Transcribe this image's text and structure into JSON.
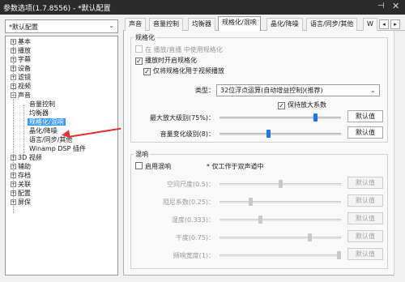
{
  "window": {
    "title": "参数选项(1.7.8556) - *默认配置",
    "pin_glyph": "⊣",
    "close_glyph": "✕"
  },
  "preset": {
    "value": "*默认配置",
    "arrow": "⌄"
  },
  "tree": {
    "items": [
      {
        "label": "基本",
        "expander": "+"
      },
      {
        "label": "播放",
        "expander": "+"
      },
      {
        "label": "字幕",
        "expander": "+"
      },
      {
        "label": "设备",
        "expander": "+"
      },
      {
        "label": "滤镜",
        "expander": "+"
      },
      {
        "label": "视频",
        "expander": "+"
      },
      {
        "label": "声音",
        "expander": "−"
      },
      {
        "label": "音量控制"
      },
      {
        "label": "均衡器"
      },
      {
        "label": "规格化/混响"
      },
      {
        "label": "晶化/降噪"
      },
      {
        "label": "语言/同步/其他"
      },
      {
        "label": "Winamp DSP 插件"
      },
      {
        "label": "3D 视频",
        "expander": "+"
      },
      {
        "label": "辅助",
        "expander": "+"
      },
      {
        "label": "存档",
        "expander": "+"
      },
      {
        "label": "关联",
        "expander": "+"
      },
      {
        "label": "配置",
        "expander": "+"
      },
      {
        "label": "屏保",
        "expander": "+"
      }
    ]
  },
  "tabs": {
    "items": [
      {
        "label": "声音"
      },
      {
        "label": "音量控制"
      },
      {
        "label": "均衡器"
      },
      {
        "label": "规格化/混响"
      },
      {
        "label": "晶化/降噪"
      },
      {
        "label": "语言/同步/其他"
      },
      {
        "label": "W"
      }
    ],
    "scroll_left": "◂",
    "scroll_right": "▸"
  },
  "normalize": {
    "group_title": "规格化",
    "only_passthrough": "在 播放/直播 中使用规格化",
    "enable_on_start": "播放时开启规格化",
    "video_only": "仅将规格化用于视频播放",
    "type_label": "类型：",
    "type_value": "32位浮点运算(自动增益控制)(推荐)",
    "keep_gain": "保持放大系数",
    "max_gain_label": "最大放大级别(75%)：",
    "max_gain_value": 0.8,
    "volume_change_label": "音量变化级别(8)：",
    "volume_change_value": 0.4,
    "reset": "默认值",
    "check_mark": "✓"
  },
  "reverb": {
    "group_title": "混响",
    "enable": "启用混响",
    "stereo_note": "* 仅工作于双声道中",
    "reset": "默认值",
    "params": [
      {
        "label": "空间尺度(0.5)：",
        "value": 0.5
      },
      {
        "label": "阻尼系数(0.25)：",
        "value": 0.25
      },
      {
        "label": "湿度(0.333)：",
        "value": 0.333
      },
      {
        "label": "干度(0.75)：",
        "value": 0.75
      },
      {
        "label": "频响宽度(1)：",
        "value": 1.0
      }
    ]
  },
  "colors": {
    "accent": "#1a73e8",
    "selection": "#3399ff",
    "annotation_arrow": "#e03030",
    "titlebar": "#2b2b2b"
  }
}
